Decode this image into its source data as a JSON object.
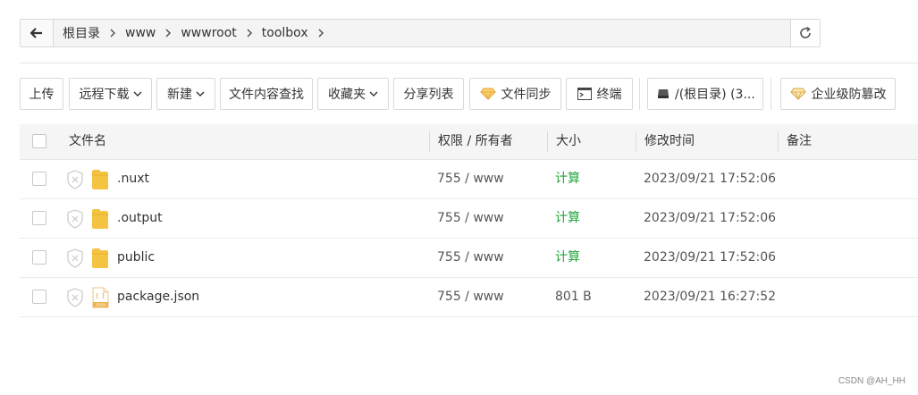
{
  "breadcrumb": {
    "items": [
      "根目录",
      "www",
      "wwwroot",
      "toolbox"
    ]
  },
  "toolbar": {
    "upload": "上传",
    "remote_download": "远程下载",
    "new": "新建",
    "content_search": "文件内容查找",
    "favorites": "收藏夹",
    "share_list": "分享列表",
    "file_sync": "文件同步",
    "terminal": "终端",
    "disk": "/(根目录) (3...",
    "tamper_proof": "企业级防篡改"
  },
  "table": {
    "headers": {
      "name": "文件名",
      "perm": "权限 / 所有者",
      "size": "大小",
      "mtime": "修改时间",
      "note": "备注"
    },
    "rows": [
      {
        "name": ".nuxt",
        "type": "folder",
        "perm": "755 / www",
        "size": "计算",
        "size_is_action": true,
        "mtime": "2023/09/21 17:52:06",
        "note": ""
      },
      {
        "name": ".output",
        "type": "folder",
        "perm": "755 / www",
        "size": "计算",
        "size_is_action": true,
        "mtime": "2023/09/21 17:52:06",
        "note": ""
      },
      {
        "name": "public",
        "type": "folder",
        "perm": "755 / www",
        "size": "计算",
        "size_is_action": true,
        "mtime": "2023/09/21 17:52:06",
        "note": ""
      },
      {
        "name": "package.json",
        "type": "json",
        "perm": "755 / www",
        "size": "801 B",
        "size_is_action": false,
        "mtime": "2023/09/21 16:27:52",
        "note": ""
      }
    ]
  },
  "json_icon_label": "JSON",
  "watermark": "CSDN @AH_HH",
  "colors": {
    "accent_green": "#20a53a",
    "folder_yellow": "#f5c342",
    "gem_gold": "#e6a23c"
  }
}
